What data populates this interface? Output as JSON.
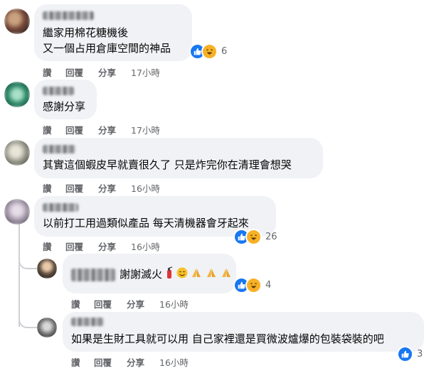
{
  "comments": [
    {
      "lines": [
        "繼家用棉花糖機後",
        "又一個占用倉庫空間的神品"
      ],
      "reaction_count": "6",
      "actions": [
        "讚",
        "回覆",
        "分享"
      ],
      "time": "17小時",
      "avatar_color": "#7a4a3a"
    },
    {
      "lines": [
        "感謝分享"
      ],
      "actions": [
        "讚",
        "回覆",
        "分享"
      ],
      "time": "17小時",
      "avatar_color": "#2f8a6a"
    },
    {
      "lines": [
        "其實這個蝦皮早就賣很久了 只是炸完你在清理會想哭"
      ],
      "actions": [
        "讚",
        "回覆",
        "分享"
      ],
      "time": "16小時",
      "avatar_color": "#8c8c80"
    },
    {
      "lines": [
        "以前打工用過類似產品 每天清機器會牙起來"
      ],
      "reaction_count": "26",
      "actions": [
        "讚",
        "回覆",
        "分享"
      ],
      "time": "16小時",
      "avatar_color": "#9a8fa0"
    }
  ],
  "replies": [
    {
      "text": "謝謝滅火",
      "emoji_icons": [
        "fire-extinguisher",
        "smile",
        "pray",
        "pray",
        "pray"
      ],
      "reaction_count": "4",
      "actions": [
        "讚",
        "回覆",
        "分享"
      ],
      "time": "16小時",
      "avatar_color": "#5b4a3e"
    },
    {
      "text": "如果是生財工具就可以用 自己家裡還是買微波爐爆的包裝袋裝的吧",
      "reaction_count": "3",
      "actions": [
        "讚",
        "回覆",
        "分享"
      ],
      "time": "16小時",
      "avatar_color": "#6a6a6a"
    }
  ],
  "colors": {
    "bubble": "#f0f2f5",
    "meta_text": "#65676b",
    "like": "#1877f2",
    "haha": "#f7b125",
    "thread_line": "#ced0d4"
  }
}
